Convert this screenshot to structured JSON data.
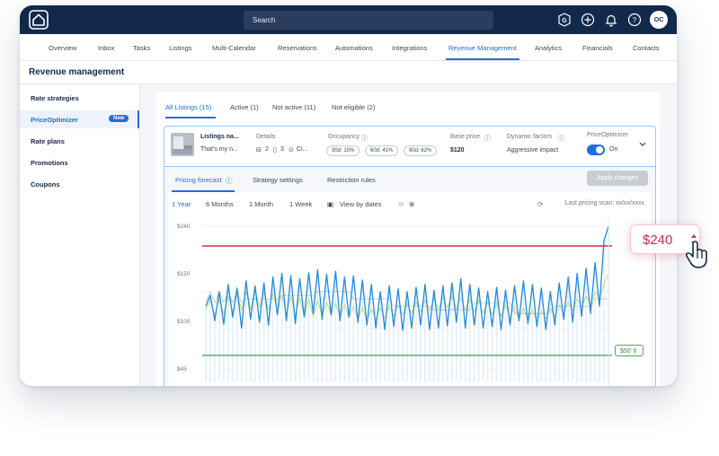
{
  "topbar": {
    "search_placeholder": "Search",
    "avatar_initials": "OC",
    "icons": [
      "g-icon",
      "add-icon",
      "bell-icon",
      "help-icon"
    ]
  },
  "nav": {
    "items": [
      {
        "label": "Overview"
      },
      {
        "label": "Inbox"
      },
      {
        "label": "Tasks"
      },
      {
        "label": "Listings"
      },
      {
        "label": "Multi-Calendar"
      },
      {
        "label": "Reservations"
      },
      {
        "label": "Automations"
      },
      {
        "label": "Integrations"
      },
      {
        "label": "Revenue Management"
      },
      {
        "label": "Analytics"
      },
      {
        "label": "Financials"
      },
      {
        "label": "Contacts"
      }
    ],
    "active": "Revenue Management"
  },
  "page": {
    "title": "Revenue management"
  },
  "sidebar": {
    "items": [
      {
        "label": "Rate strategies"
      },
      {
        "label": "PriceOptimizer"
      },
      {
        "label": "Rate plans"
      },
      {
        "label": "Promotions"
      },
      {
        "label": "Coupons"
      }
    ],
    "badge": "New"
  },
  "filters": {
    "tabs": [
      {
        "label": "All Listings (15)"
      },
      {
        "label": "Active (1)"
      },
      {
        "label": "Not active (11)"
      },
      {
        "label": "Not eligible (2)"
      }
    ]
  },
  "listing": {
    "name": "Listings na...",
    "subtitle": "That's my n...",
    "details_label": "Details",
    "bedrooms": "2",
    "bathrooms": "3",
    "location": "Ci...",
    "occupancy_label": "Occupancy",
    "occupancy": [
      "30d: 15%",
      "60d: 41%",
      "90d: 62%"
    ],
    "base_price_label": "Base price",
    "base_price": "$120",
    "dynamic_label": "Dynamic factors",
    "dynamic_value": "Aggressive impact",
    "optimizer_label": "PriceOptimizer",
    "optimizer_state": "On"
  },
  "forecast": {
    "tabs": [
      {
        "label": "Pricing forecast"
      },
      {
        "label": "Strategy settings"
      },
      {
        "label": "Restriction rules"
      }
    ],
    "apply_label": "Apply changes",
    "ranges": [
      {
        "label": "1 Year"
      },
      {
        "label": "6 Months"
      },
      {
        "label": "1 Month"
      },
      {
        "label": "1 Week"
      }
    ],
    "view_by_dates": "View by dates",
    "last_scan": "Last pricing scan: xx/xx/xxxx"
  },
  "floating": {
    "max_price": "$240",
    "min_price": "$50"
  },
  "chart_data": {
    "type": "line",
    "y_ticks": [
      "$240",
      "$150",
      "$100",
      "$45"
    ],
    "ylim": [
      45,
      240
    ],
    "max_threshold": 240,
    "min_threshold": 50,
    "series": [
      {
        "values": [
          130,
          145,
          110,
          150,
          105,
          160,
          115,
          155,
          100,
          165,
          112,
          158,
          108,
          162,
          104,
          170,
          118,
          175,
          110,
          172,
          106,
          168,
          115,
          176,
          120,
          180,
          112,
          174,
          118,
          178,
          110,
          170,
          115,
          172,
          108,
          166,
          104,
          160,
          100,
          150,
          98,
          158,
          102,
          154,
          97,
          150,
          100,
          156,
          104,
          160,
          98,
          152,
          100,
          158,
          103,
          162,
          108,
          168,
          100,
          160,
          104,
          155,
          100,
          150,
          102,
          156,
          98,
          152,
          104,
          158,
          110,
          165,
          106,
          160,
          102,
          155,
          98,
          150,
          104,
          162,
          112,
          170,
          108,
          175,
          116,
          182,
          120,
          190,
          130,
          220,
          240
        ]
      },
      {
        "values": [
          125,
          138,
          118,
          140,
          120,
          145,
          122,
          148,
          124,
          150,
          126,
          152,
          128,
          150,
          125,
          148,
          122,
          146,
          120,
          144,
          118,
          142,
          116,
          140,
          115,
          138,
          117,
          136,
          118,
          134,
          116,
          132,
          114,
          130,
          112,
          128,
          110,
          126,
          112,
          128,
          114,
          130,
          116,
          132,
          118,
          134,
          120,
          136,
          122,
          138,
          124,
          140,
          126,
          142,
          128,
          144,
          126,
          142,
          124,
          140,
          122,
          138,
          120,
          136,
          118,
          134,
          116,
          132,
          114,
          130,
          112,
          128,
          110,
          126,
          108,
          124,
          112,
          128,
          116,
          132,
          120,
          136,
          124,
          140,
          128,
          144,
          132,
          150,
          140,
          160,
          175
        ]
      },
      {
        "values": [
          135,
          150,
          135,
          150,
          135,
          150,
          135,
          150,
          135,
          140,
          140,
          140,
          140,
          140,
          140,
          140,
          140,
          145,
          145,
          145,
          145,
          145,
          145,
          145,
          145,
          150,
          150,
          150,
          150,
          150,
          150,
          150,
          150,
          140,
          140,
          140,
          140,
          140,
          140,
          140,
          140,
          140,
          130,
          130,
          130,
          130,
          130,
          130,
          130,
          130,
          130,
          125,
          125,
          125,
          125,
          125,
          125,
          125,
          125,
          125,
          135,
          135,
          135,
          135,
          135,
          135,
          135,
          135,
          135,
          120,
          120,
          120,
          120,
          120,
          120,
          120,
          120,
          120,
          130,
          130,
          130,
          130,
          130,
          130,
          130,
          130,
          130,
          140,
          140,
          140,
          140
        ]
      }
    ]
  }
}
